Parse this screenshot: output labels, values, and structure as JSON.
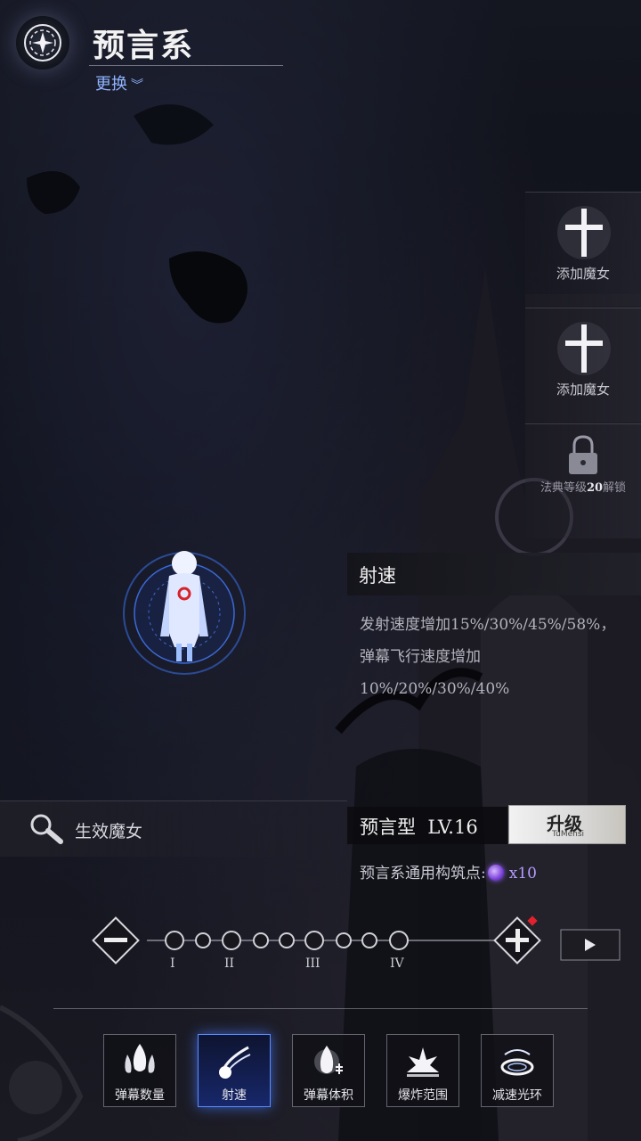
{
  "header": {
    "title": "预言系",
    "switch_label": "更换"
  },
  "slots": [
    {
      "label": "添加魔女",
      "icon": "cross-icon"
    },
    {
      "label": "添加魔女",
      "icon": "cross-icon"
    },
    {
      "label_pre": "法典等级",
      "label_level": "20",
      "label_post": "解锁",
      "icon": "lock-icon"
    }
  ],
  "skill": {
    "name": "射速",
    "description": "发射速度增加15%/30%/45%/58%，弹幕飞行速度增加10%/20%/30%/40%"
  },
  "effective": {
    "label": "生效魔女"
  },
  "type": {
    "name": "预言型",
    "level": "LV.16",
    "upgrade_label": "升级",
    "upgrade_sub": "TuMensi"
  },
  "points": {
    "label": "预言系通用构筑点:",
    "count": "x10"
  },
  "track": {
    "roman": [
      "I",
      "II",
      "III",
      "IV"
    ]
  },
  "tabs": [
    {
      "label": "弹幕数量",
      "icon": "barrage-count-icon",
      "active": false
    },
    {
      "label": "射速",
      "icon": "fire-rate-icon",
      "active": true
    },
    {
      "label": "弹幕体积",
      "icon": "barrage-size-icon",
      "active": false
    },
    {
      "label": "爆炸范围",
      "icon": "explosion-range-icon",
      "active": false
    },
    {
      "label": "减速光环",
      "icon": "slow-aura-icon",
      "active": false
    }
  ],
  "colors": {
    "accent_blue": "#8fb4ff",
    "active_tab": "#5a8cff",
    "orb": "#7a40d8"
  }
}
